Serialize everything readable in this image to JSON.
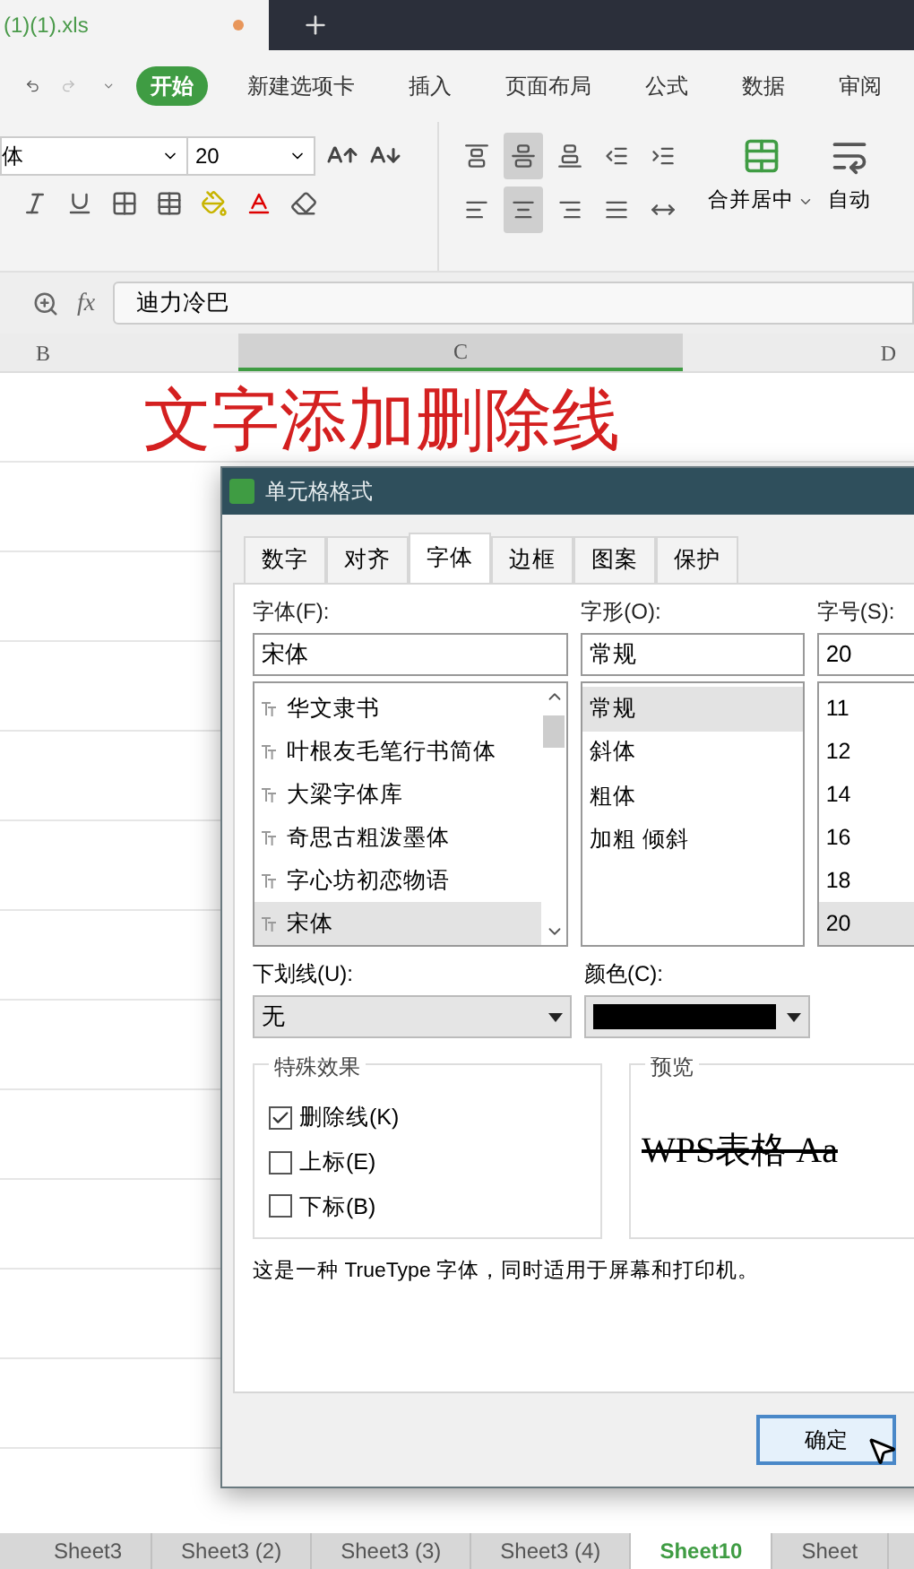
{
  "document_tab": {
    "title": "(1)(1).xls",
    "modified": true
  },
  "menu": [
    {
      "label": "开始",
      "selected": true
    },
    {
      "label": "新建选项卡",
      "selected": false
    },
    {
      "label": "插入",
      "selected": false
    },
    {
      "label": "页面布局",
      "selected": false
    },
    {
      "label": "公式",
      "selected": false
    },
    {
      "label": "数据",
      "selected": false
    },
    {
      "label": "审阅",
      "selected": false
    }
  ],
  "font_name": "体",
  "font_size": "20",
  "align_buttons": [
    {
      "kind": "top",
      "selected": false
    },
    {
      "kind": "middle",
      "selected": true
    },
    {
      "kind": "bottom",
      "selected": false
    },
    {
      "kind": "outdent",
      "selected": false
    },
    {
      "kind": "indent",
      "selected": false
    },
    {
      "kind": "left",
      "selected": false
    },
    {
      "kind": "center",
      "selected": true
    },
    {
      "kind": "right",
      "selected": false
    },
    {
      "kind": "justify",
      "selected": false
    },
    {
      "kind": "distributed",
      "selected": false
    }
  ],
  "merge_label": "合并居中",
  "wrap_label": "自动",
  "formula": {
    "fx": "fx",
    "value": "迪力冷巴"
  },
  "columns": [
    {
      "label": "B",
      "selected": false
    },
    {
      "label": "C",
      "selected": true
    },
    {
      "label": "D",
      "selected": false
    }
  ],
  "cell_text": "文字添加删除线",
  "dialog": {
    "title": "单元格格式",
    "tabs": [
      {
        "label": "数字",
        "selected": false
      },
      {
        "label": "对齐",
        "selected": false
      },
      {
        "label": "字体",
        "selected": true
      },
      {
        "label": "边框",
        "selected": false
      },
      {
        "label": "图案",
        "selected": false
      },
      {
        "label": "保护",
        "selected": false
      }
    ],
    "font": {
      "label": "字体(F):",
      "value": "宋体",
      "items": [
        {
          "label": "华文隶书",
          "selected": false
        },
        {
          "label": "叶根友毛笔行书简体",
          "selected": false
        },
        {
          "label": "大梁字体库",
          "selected": false
        },
        {
          "label": "奇思古粗泼墨体",
          "selected": false
        },
        {
          "label": "字心坊初恋物语",
          "selected": false
        },
        {
          "label": "宋体",
          "selected": true
        }
      ]
    },
    "style": {
      "label": "字形(O):",
      "value": "常规",
      "items": [
        {
          "label": "常规",
          "selected": true
        },
        {
          "label": "斜体",
          "selected": false
        },
        {
          "label": "粗体",
          "selected": false
        },
        {
          "label": "加粗 倾斜",
          "selected": false
        }
      ]
    },
    "size": {
      "label": "字号(S):",
      "value": "20",
      "items": [
        {
          "label": "11",
          "selected": false
        },
        {
          "label": "12",
          "selected": false
        },
        {
          "label": "14",
          "selected": false
        },
        {
          "label": "16",
          "selected": false
        },
        {
          "label": "18",
          "selected": false
        },
        {
          "label": "20",
          "selected": true
        }
      ]
    },
    "underline": {
      "label": "下划线(U):",
      "value": "无"
    },
    "color": {
      "label": "颜色(C):"
    },
    "effects": {
      "title": "特殊效果",
      "items": [
        {
          "label": "删除线(K)",
          "checked": true
        },
        {
          "label": "上标(E)",
          "checked": false
        },
        {
          "label": "下标(B)",
          "checked": false
        }
      ]
    },
    "preview": {
      "title": "预览",
      "text": "WPS表格 Aa",
      "strikethrough": true
    },
    "note": "这是一种 TrueType 字体，同时适用于屏幕和打印机。",
    "ok": "确定"
  },
  "sheet_tabs": [
    {
      "label": "Sheet3",
      "selected": false
    },
    {
      "label": "Sheet3 (2)",
      "selected": false
    },
    {
      "label": "Sheet3 (3)",
      "selected": false
    },
    {
      "label": "Sheet3 (4)",
      "selected": false
    },
    {
      "label": "Sheet10",
      "selected": true
    },
    {
      "label": "Sheet",
      "selected": false
    }
  ]
}
